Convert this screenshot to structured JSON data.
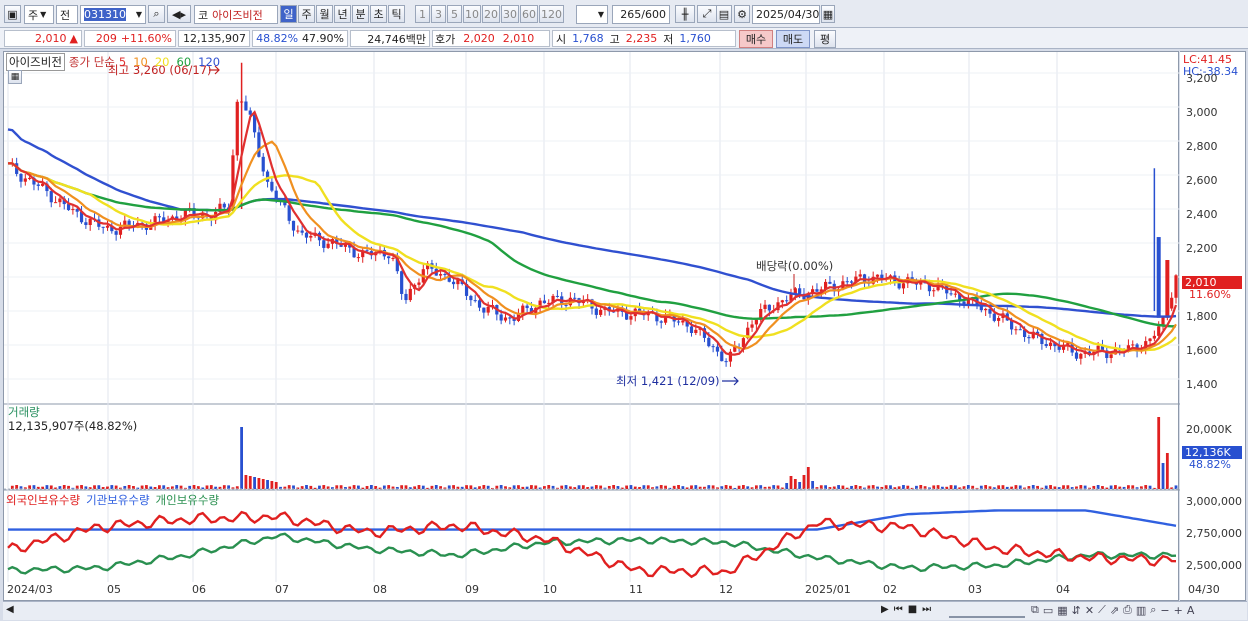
{
  "toolbar": {
    "market": "주",
    "period_btn": "전",
    "code": "031310",
    "name": "아이즈비전",
    "tf": [
      "일",
      "주",
      "월",
      "년",
      "분",
      "초",
      "틱"
    ],
    "tf_selected": "일",
    "counts": [
      "1",
      "3",
      "5",
      "10",
      "20",
      "30",
      "60",
      "120"
    ],
    "count_value": "265",
    "count_total": "/600",
    "date": "2025/04/30",
    "code_prefix": "코"
  },
  "quote": {
    "price": "2,010",
    "up_mark": "▲",
    "change": "209",
    "rate": "+11.60%",
    "volume": "12,135,907",
    "turnover": "48.82%",
    "ratio": "47.90%",
    "amount": "24,746백만",
    "hoga_label": "호가",
    "ask": "2,020",
    "bid": "2,010",
    "open_label": "시",
    "open": "1,768",
    "high_label": "고",
    "high": "2,235",
    "low_label": "저",
    "low": "1,760",
    "buy": "매수",
    "sell": "매도",
    "eval": "평"
  },
  "price_pane": {
    "name_tag": "아이즈비전",
    "legend_label": "종가 단순",
    "ma": [
      {
        "p": "5",
        "c": "#e03030"
      },
      {
        "p": "10",
        "c": "#f09020"
      },
      {
        "p": "20",
        "c": "#f0e020"
      },
      {
        "p": "60",
        "c": "#20a040"
      },
      {
        "p": "120",
        "c": "#3050d0"
      }
    ],
    "high_note": "최고 3,260 (06/17)",
    "low_note": "최저 1,421 (12/09)",
    "div_note": "배당락(0.00%)",
    "lc": "LC:41.45",
    "hc": "HC:-38.34",
    "cur_price": "2,010",
    "cur_rate": "11.60%",
    "yticks": [
      "3,200",
      "3,000",
      "2,800",
      "2,600",
      "2,400",
      "2,200",
      "2,000",
      "1,800",
      "1,600",
      "1,400"
    ]
  },
  "volume_pane": {
    "title": "거래량",
    "value": "12,135,907주(48.82%)",
    "ytick": "20,000K",
    "cur": "12,136K",
    "cur_rate": "48.82%"
  },
  "holder_pane": {
    "legend": [
      {
        "name": "외국인보유수량",
        "c": "#e02020"
      },
      {
        "name": "기관보유수량",
        "c": "#3060e0"
      },
      {
        "name": "개인보유수량",
        "c": "#2a9050"
      }
    ],
    "yticks": [
      "3,000,000",
      "2,750,000",
      "2,500,000"
    ]
  },
  "xaxis": [
    "2024/03",
    "05",
    "06",
    "07",
    "08",
    "09",
    "10",
    "11",
    "12",
    "2025/01",
    "02",
    "03",
    "04"
  ],
  "xaxis_end": "04/30",
  "colors": {
    "up": "#e02020",
    "down": "#2850d0",
    "ma5": "#e03030",
    "ma10": "#f09020",
    "ma20": "#f0e020",
    "ma60": "#20a040",
    "ma120": "#3050d0"
  },
  "chart_data": {
    "type": "line",
    "price_close_approx": {
      "x": [
        "2024/03",
        "05",
        "06",
        "06/17",
        "07",
        "08",
        "09",
        "10",
        "11",
        "12/09",
        "2025/01",
        "02",
        "03",
        "04",
        "04/30"
      ],
      "y": [
        2650,
        2300,
        2400,
        3260,
        2200,
        2050,
        1750,
        1850,
        1780,
        1421,
        1900,
        2000,
        1800,
        1550,
        2010
      ]
    },
    "series": [
      {
        "name": "외국인보유수량",
        "y": [
          2640000,
          2820000,
          2880000,
          2900000,
          2780000,
          2830000,
          2720000,
          2480000,
          2470000,
          2850000,
          2820000,
          2650000,
          2580000,
          2560000
        ]
      },
      {
        "name": "기관보유수량",
        "y": [
          2800000,
          2800000,
          2800000,
          2800000,
          2800000,
          2800000,
          2800000,
          2800000,
          2800000,
          2800000,
          2920000,
          2950000,
          2950000,
          2830000
        ]
      },
      {
        "name": "개인보유수량",
        "y": [
          2480000,
          2500000,
          2600000,
          2750000,
          2650000,
          2600000,
          2700000,
          2720000,
          2700000,
          2580000,
          2500000,
          2520000,
          2600000,
          2600000
        ]
      }
    ]
  }
}
